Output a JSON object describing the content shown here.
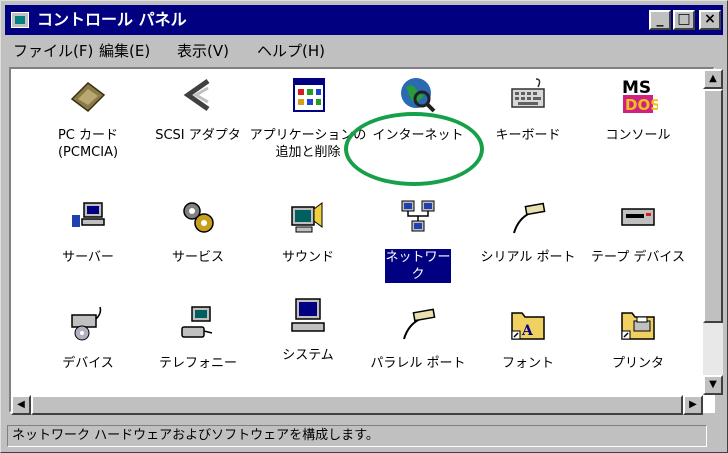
{
  "window": {
    "title": "コントロール パネル",
    "minimize": "_",
    "maximize": "□",
    "close": "×"
  },
  "menu": [
    "ファイル(F)",
    "編集(E)",
    "表示(V)",
    "ヘルプ(H)"
  ],
  "items": [
    {
      "label": "PC カード\n(PCMCIA)",
      "icon": "pc-card-icon"
    },
    {
      "label": "SCSI アダプタ",
      "icon": "scsi-adapter-icon"
    },
    {
      "label": "アプリケーションの\n追加と削除",
      "icon": "add-remove-programs-icon"
    },
    {
      "label": "インターネット",
      "icon": "internet-globe-icon"
    },
    {
      "label": "キーボード",
      "icon": "keyboard-icon"
    },
    {
      "label": "コンソール",
      "icon": "ms-dos-console-icon"
    },
    {
      "label": "サーバー",
      "icon": "server-icon"
    },
    {
      "label": "サービス",
      "icon": "services-gears-icon"
    },
    {
      "label": "サウンド",
      "icon": "sound-icon"
    },
    {
      "label": "ネットワーク",
      "icon": "network-icon",
      "selected": true
    },
    {
      "label": "シリアル ポート",
      "icon": "serial-port-icon"
    },
    {
      "label": "テープ デバイス",
      "icon": "tape-device-icon"
    },
    {
      "label": "デバイス",
      "icon": "devices-icon"
    },
    {
      "label": "テレフォニー",
      "icon": "telephony-icon"
    },
    {
      "label": "システム",
      "icon": "system-computer-icon"
    },
    {
      "label": "パラレル ポート",
      "icon": "parallel-port-icon"
    },
    {
      "label": "フォント",
      "icon": "fonts-folder-icon"
    },
    {
      "label": "プリンタ",
      "icon": "printers-folder-icon"
    }
  ],
  "scroll": {
    "up": "▲",
    "down": "▼",
    "left": "◀",
    "right": "▶"
  },
  "status": "ネットワーク ハードウェアおよびソフトウェアを構成します。",
  "colors": {
    "titlebar": "#000080",
    "selection": "#000080",
    "highlight_ring": "#17a04a"
  }
}
